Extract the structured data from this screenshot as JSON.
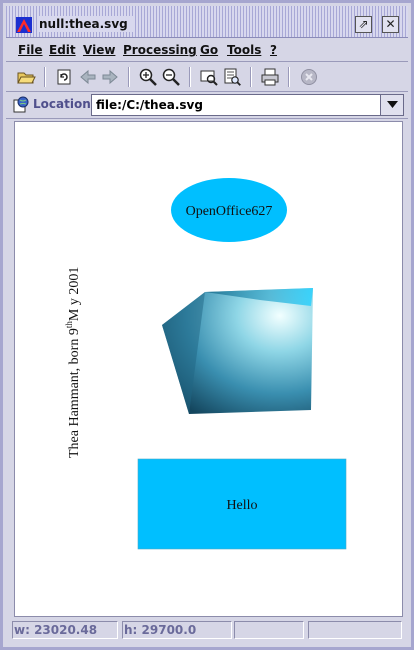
{
  "window": {
    "title": "null:thea.svg",
    "maximize_glyph": "⇗",
    "close_glyph": "✕"
  },
  "menu": [
    "File",
    "Edit",
    "View",
    "Processing",
    "Go",
    "Tools",
    "?"
  ],
  "toolbar": {
    "icons": [
      "open-folder-icon",
      "reload-icon",
      "back-arrow-icon",
      "forward-arrow-icon",
      "zoom-in-icon",
      "zoom-out-icon",
      "find-icon",
      "view-source-icon",
      "print-icon",
      "stop-icon"
    ]
  },
  "location": {
    "label": "Location:",
    "value": "file:/C:/thea.svg"
  },
  "document": {
    "ellipse_text": "OpenOffice627",
    "vertical_text_prefix": "Thea Hammant, born 9",
    "vertical_text_sup": "th",
    "vertical_text_suffix": "M y 2001",
    "rect_text": "Hello",
    "colors": {
      "fill": "#00bfff",
      "cube_dark": "#1a5c7a",
      "cube_mid": "#3a9ab8",
      "cube_light": "#e6fbff"
    }
  },
  "status": {
    "width": "w: 23020.48",
    "height": "h: 29700.0",
    "cell3": "",
    "cell4": ""
  }
}
